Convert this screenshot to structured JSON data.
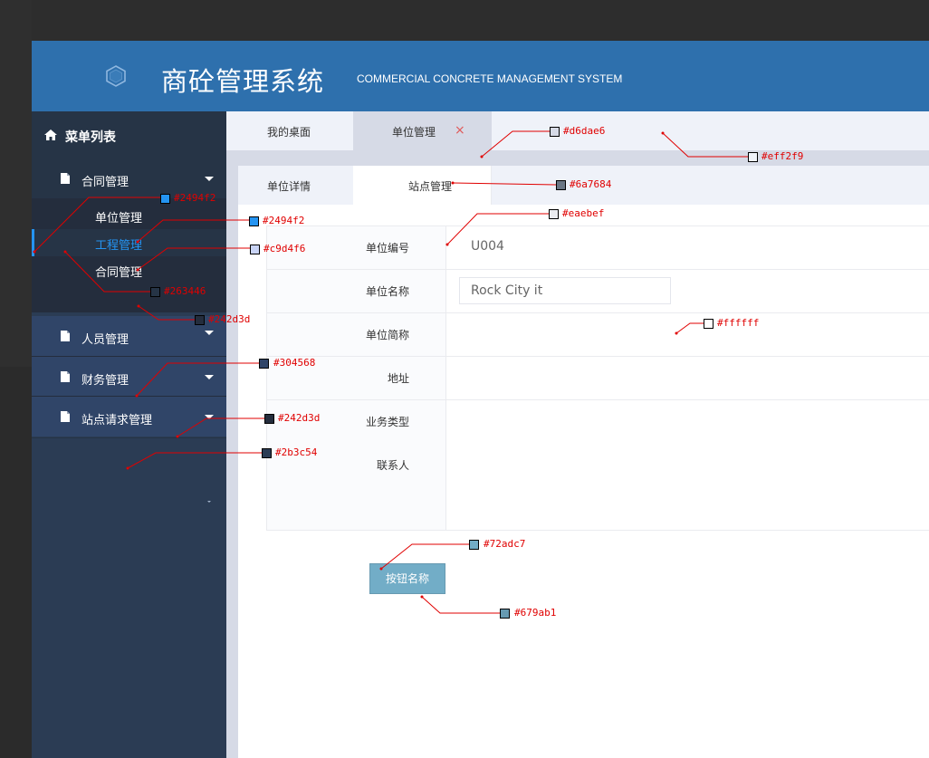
{
  "header": {
    "title": "商砼管理系统",
    "subtitle": "COMMERCIAL CONCRETE MANAGEMENT SYSTEM",
    "logo_icon": "hexagon-icon"
  },
  "sidebar": {
    "menu_title": "菜单列表",
    "groups": [
      {
        "label": "合同管理",
        "items": [
          "单位管理",
          "工程管理",
          "合同管理"
        ],
        "active_item": "工程管理"
      },
      {
        "label": "人员管理"
      },
      {
        "label": "财务管理"
      },
      {
        "label": "站点请求管理"
      }
    ]
  },
  "top_tabs": [
    {
      "label": "我的桌面"
    },
    {
      "label": "单位管理",
      "close": "×"
    }
  ],
  "sub_tabs": [
    {
      "label": "单位详情"
    },
    {
      "label": "站点管理"
    }
  ],
  "form": {
    "fields": [
      {
        "label": "单位编号",
        "value": "U004"
      },
      {
        "label": "单位名称",
        "value": "Rock City  it"
      },
      {
        "label": "单位简称",
        "value": ""
      },
      {
        "label": "地址",
        "value": ""
      },
      {
        "label": "业务类型",
        "value": ""
      },
      {
        "label": "联系人",
        "value": ""
      }
    ]
  },
  "button": {
    "label": "按钮名称"
  },
  "color_annotations": [
    {
      "hex": "#d6dae6"
    },
    {
      "hex": "#eff2f9"
    },
    {
      "hex": "#6a7684"
    },
    {
      "hex": "#eaebef"
    },
    {
      "hex": "#2494f2"
    },
    {
      "hex": "#2494f2"
    },
    {
      "hex": "#c9d4f6"
    },
    {
      "hex": "#263446"
    },
    {
      "hex": "#242d3d"
    },
    {
      "hex": "#ffffff"
    },
    {
      "hex": "#304568"
    },
    {
      "hex": "#242d3d"
    },
    {
      "hex": "#2b3c54"
    },
    {
      "hex": "#72adc7"
    },
    {
      "hex": "#679ab1"
    }
  ]
}
